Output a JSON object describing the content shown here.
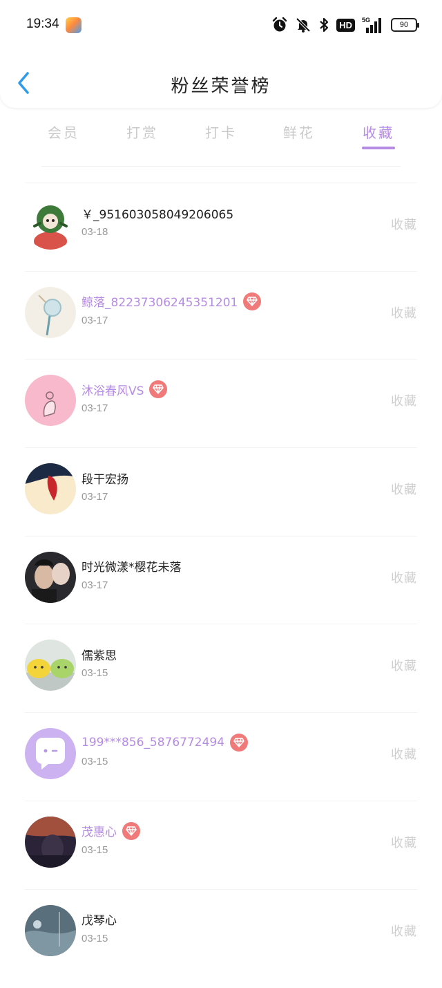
{
  "status_bar": {
    "time": "19:34",
    "hd_label": "HD",
    "battery_level": "90",
    "network": "5G"
  },
  "header": {
    "title": "粉丝荣誉榜"
  },
  "tabs": [
    {
      "label": "会员",
      "active": false
    },
    {
      "label": "打赏",
      "active": false
    },
    {
      "label": "打卡",
      "active": false
    },
    {
      "label": "鲜花",
      "active": false
    },
    {
      "label": "收藏",
      "active": true
    }
  ],
  "colors": {
    "accent": "#b68be3",
    "badge": "#f07a7a",
    "inactive_tab": "#c9c9c9",
    "date": "#999999",
    "back_arrow": "#2f9be8"
  },
  "fans": [
    {
      "name": "￥_951603058049206065",
      "date": "03-18",
      "vip": false,
      "action": "收藏"
    },
    {
      "name": "鲸落_82237306245351201",
      "date": "03-17",
      "vip": true,
      "action": "收藏"
    },
    {
      "name": "沐浴春风VS",
      "date": "03-17",
      "vip": true,
      "action": "收藏"
    },
    {
      "name": "段干宏扬",
      "date": "03-17",
      "vip": false,
      "action": "收藏"
    },
    {
      "name": "时光微漾*樱花未落",
      "date": "03-17",
      "vip": false,
      "action": "收藏"
    },
    {
      "name": "儒紫思",
      "date": "03-15",
      "vip": false,
      "action": "收藏"
    },
    {
      "name": "199***856_5876772494",
      "date": "03-15",
      "vip": true,
      "action": "收藏"
    },
    {
      "name": "茂惠心",
      "date": "03-15",
      "vip": true,
      "action": "收藏"
    },
    {
      "name": "戊琴心",
      "date": "03-15",
      "vip": false,
      "action": "收藏"
    }
  ]
}
